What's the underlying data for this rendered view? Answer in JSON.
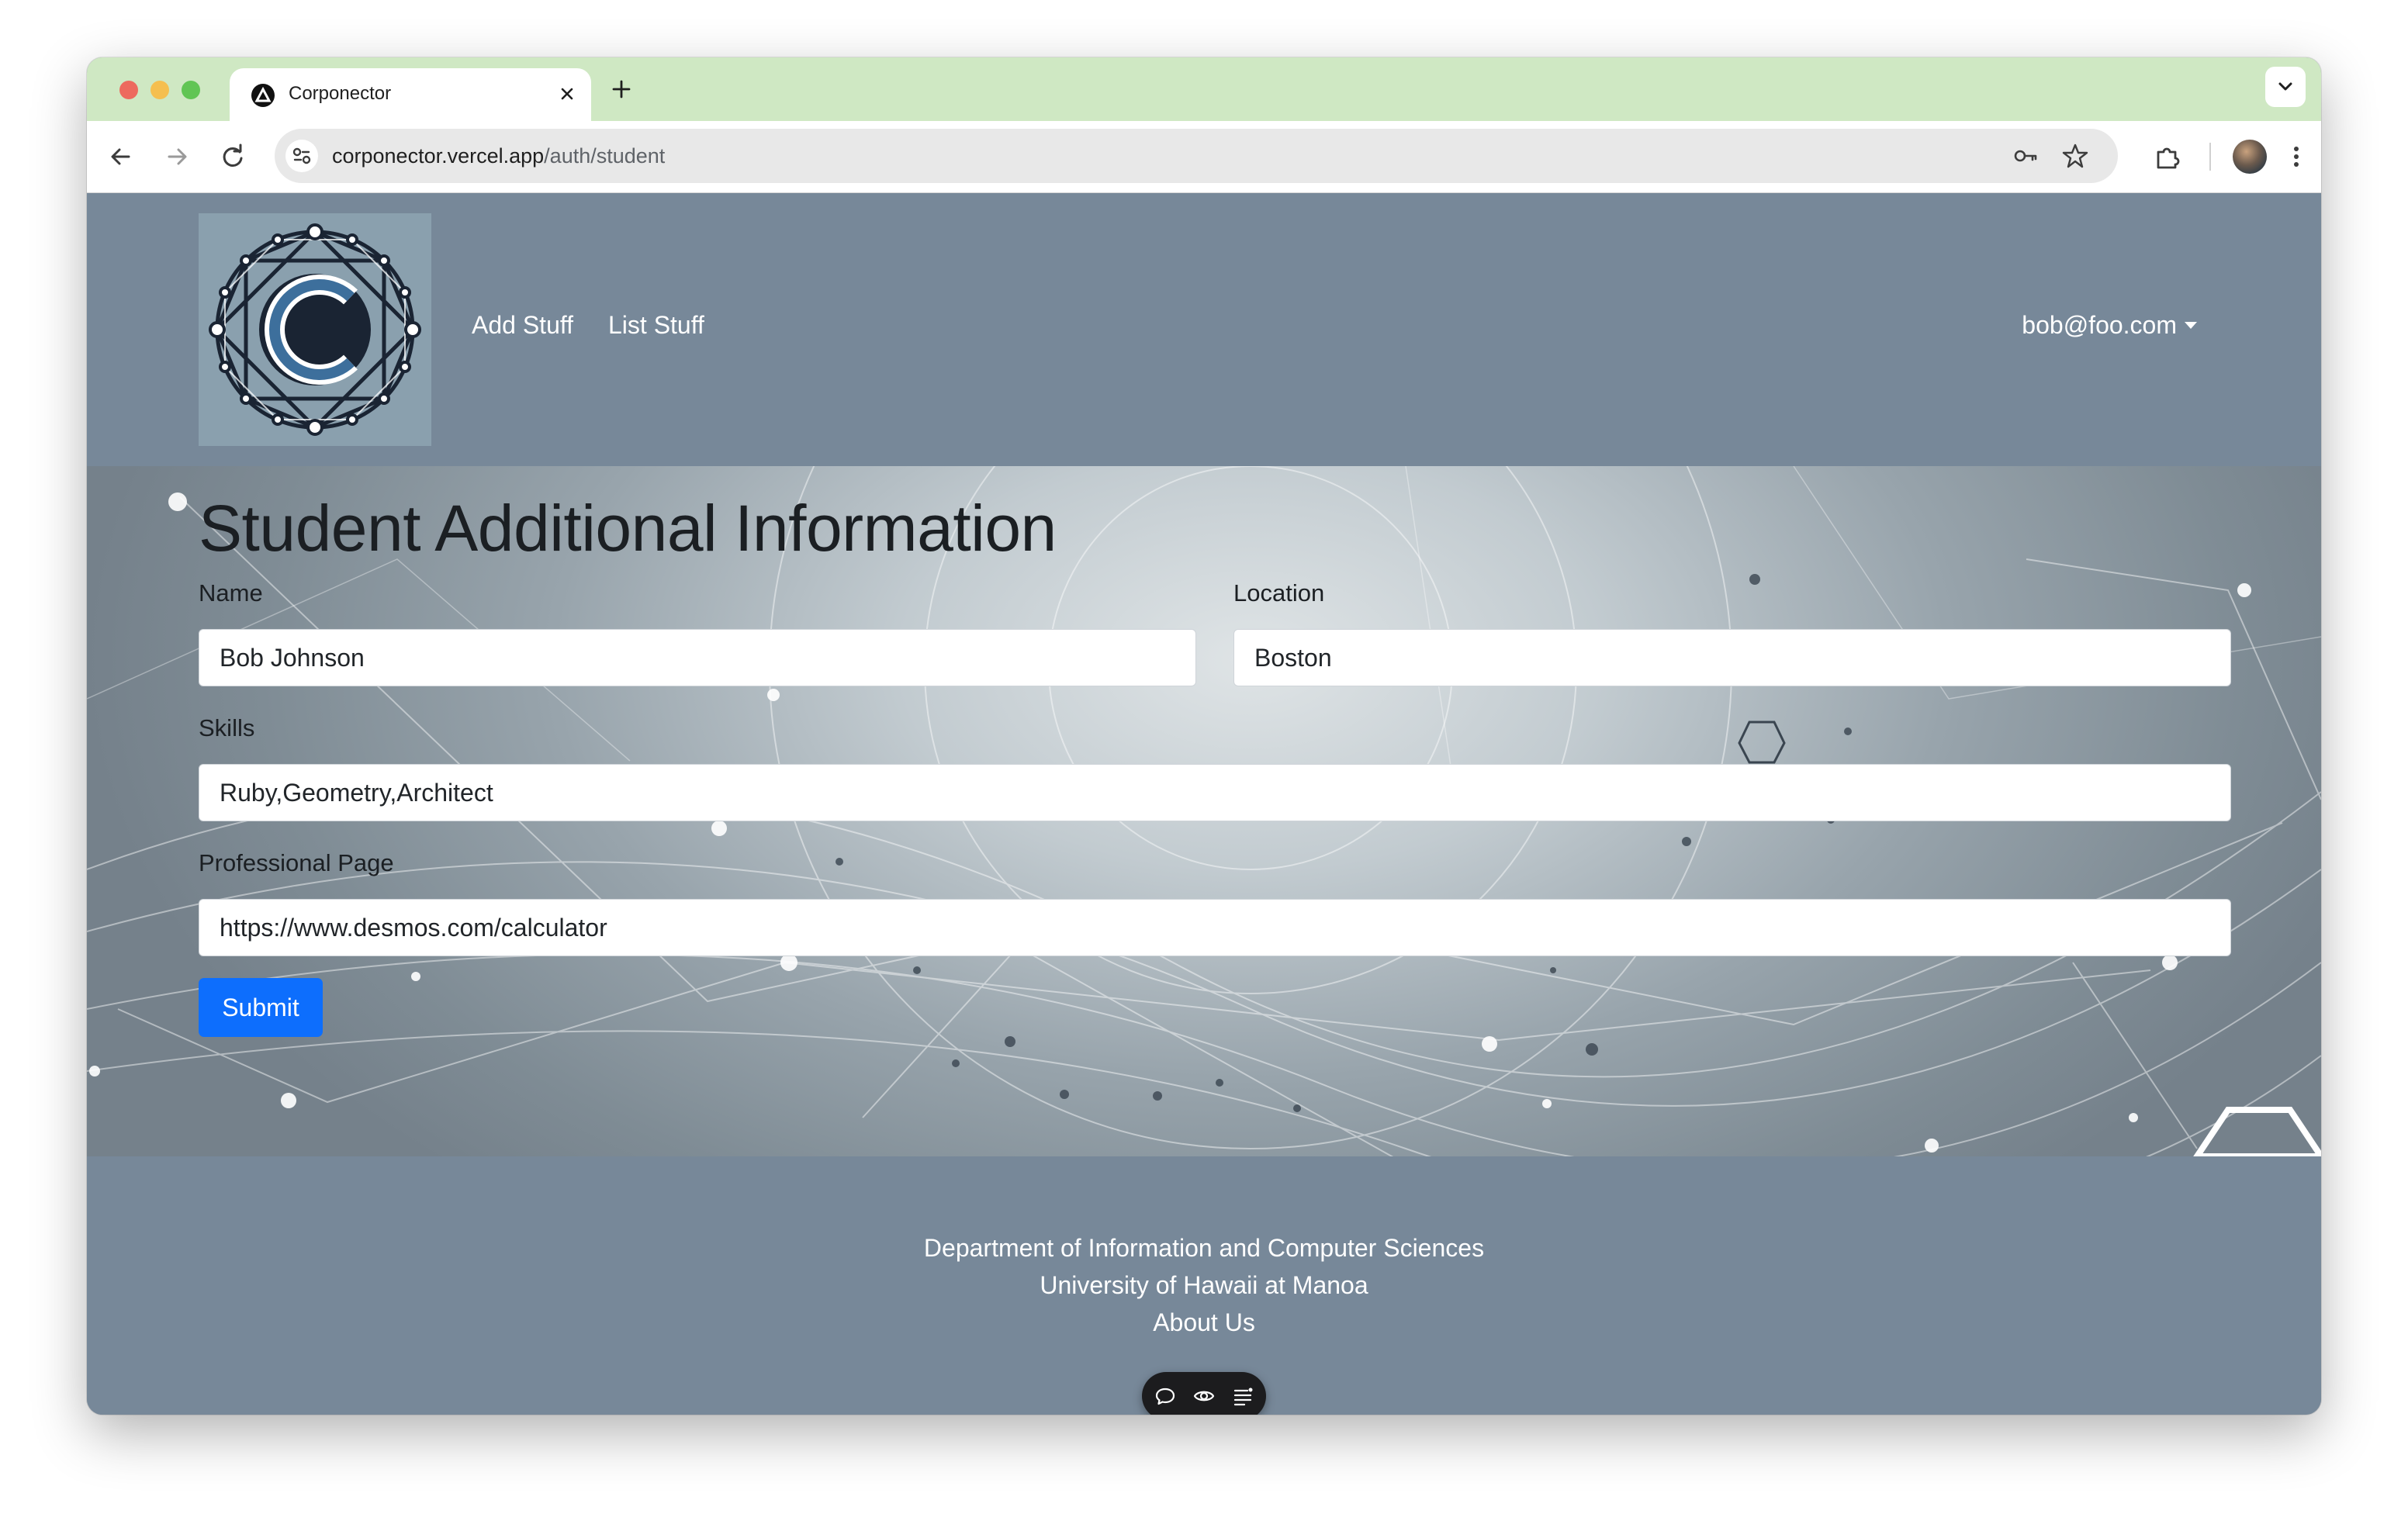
{
  "browser": {
    "tab_title": "Corponector",
    "url_domain": "corponector.vercel.app",
    "url_path": "/auth/student",
    "icons": [
      "back-icon",
      "forward-icon",
      "reload-icon",
      "site-info-icon",
      "password-key-icon",
      "bookmark-star-icon",
      "extensions-icon",
      "profile-avatar",
      "more-menu-icon",
      "tab-list-chevron-icon",
      "new-tab-plus-icon",
      "close-tab-icon"
    ]
  },
  "navbar": {
    "links": [
      "Add Stuff",
      "List Stuff"
    ],
    "user": "bob@foo.com"
  },
  "form": {
    "title": "Student Additional Information",
    "name_label": "Name",
    "name_value": "Bob Johnson",
    "location_label": "Location",
    "location_value": "Boston",
    "skills_label": "Skills",
    "skills_value": "Ruby,Geometry,Architect",
    "page_label": "Professional Page",
    "page_value": "https://www.desmos.com/calculator",
    "submit_label": "Submit"
  },
  "footer": {
    "line1": "Department of Information and Computer Sciences",
    "line2": "University of Hawaii at Manoa",
    "line3": "About Us"
  },
  "floating_toolbar": {
    "icons": [
      "comment-icon",
      "eye-icon",
      "list-icon"
    ]
  },
  "colors": {
    "tab_strip": "#cfe8c3",
    "navbar": "#778899",
    "submit": "#0d6efd"
  }
}
